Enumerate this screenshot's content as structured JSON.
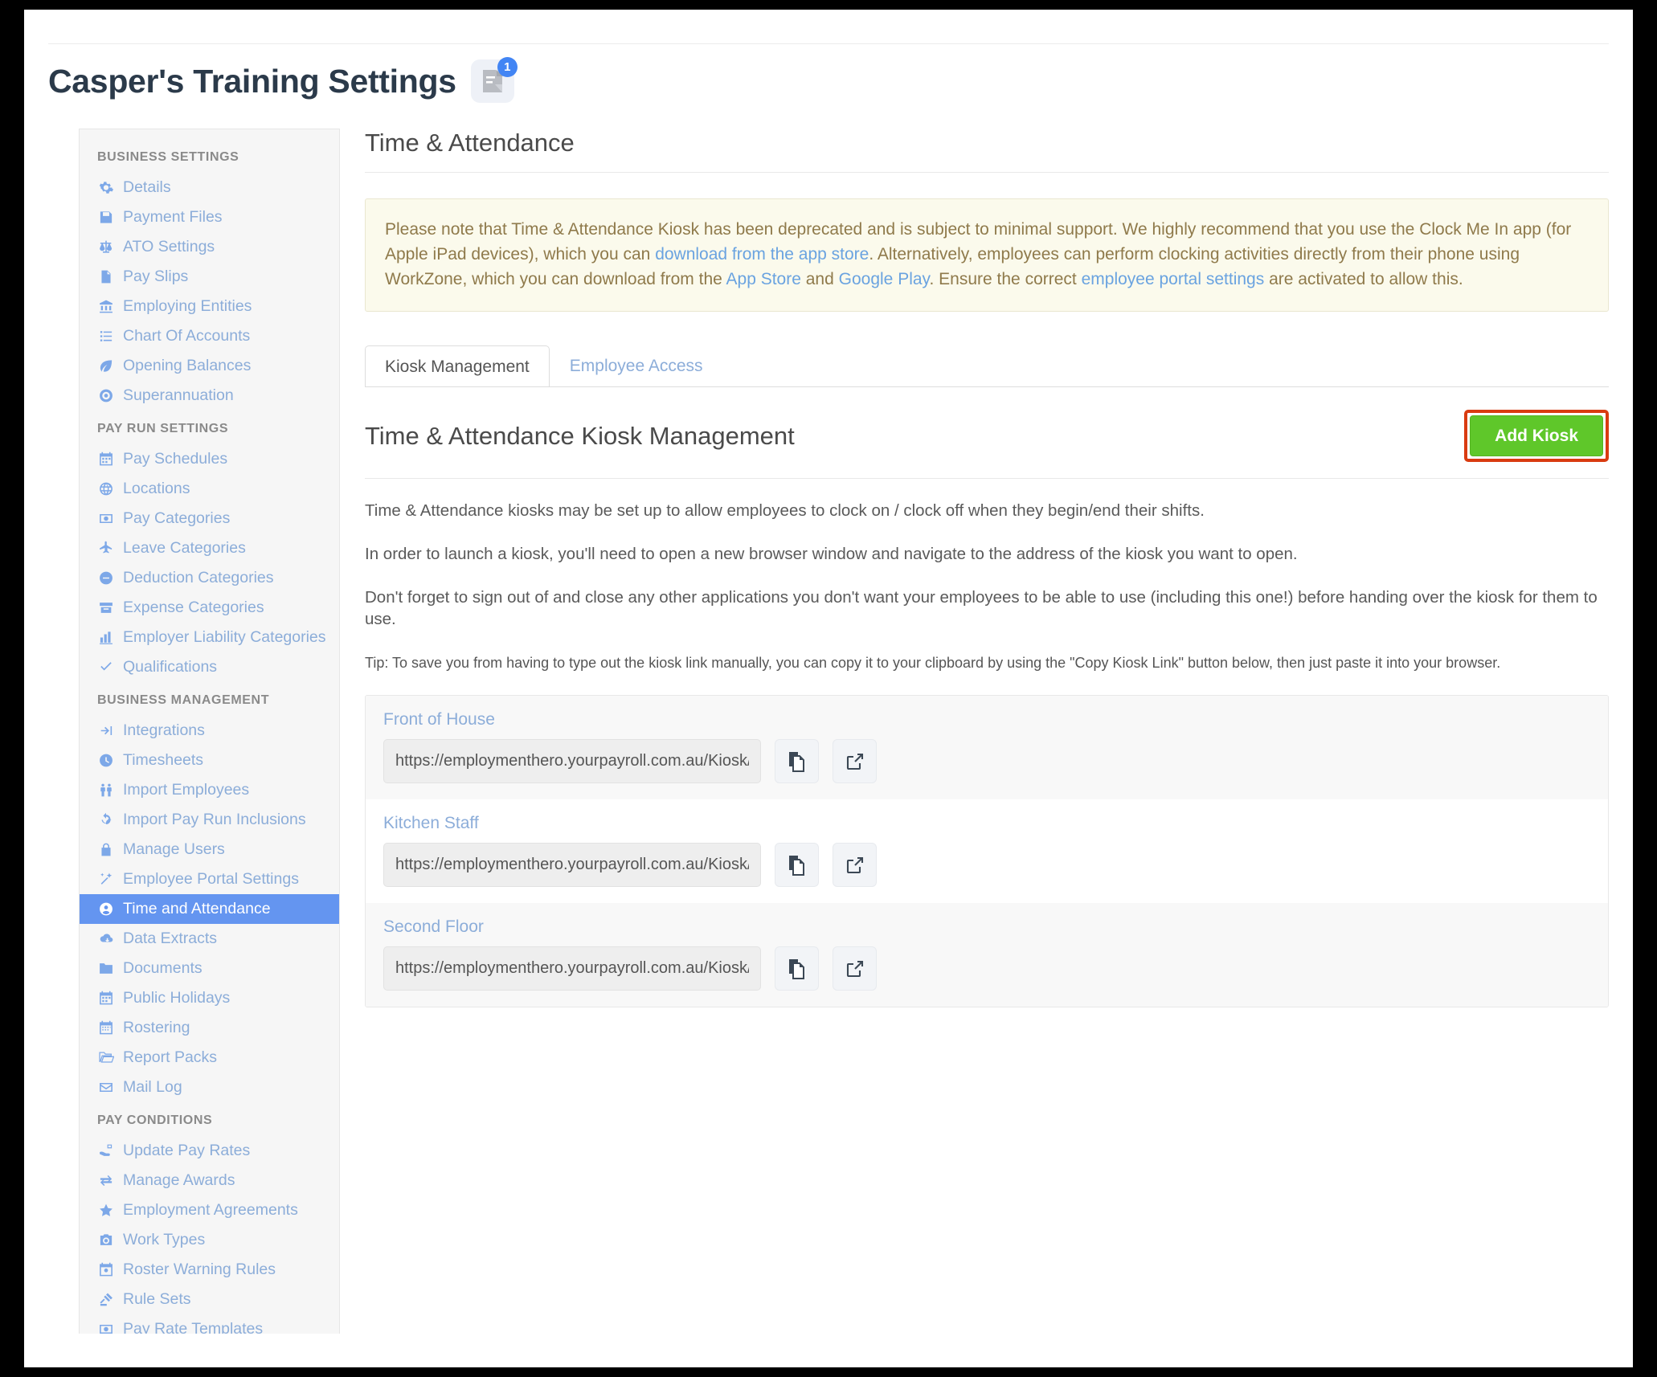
{
  "page": {
    "title": "Casper's Training Settings",
    "badge_count": "1",
    "badge_icon": "document-note-icon"
  },
  "sidebar": {
    "groups": [
      {
        "title": "BUSINESS SETTINGS",
        "items": [
          {
            "label": "Details",
            "icon": "gear-icon"
          },
          {
            "label": "Payment Files",
            "icon": "floppy-disk-icon"
          },
          {
            "label": "ATO Settings",
            "icon": "balance-scale-icon"
          },
          {
            "label": "Pay Slips",
            "icon": "file-icon"
          },
          {
            "label": "Employing Entities",
            "icon": "bank-icon"
          },
          {
            "label": "Chart Of Accounts",
            "icon": "list-icon"
          },
          {
            "label": "Opening Balances",
            "icon": "leaf-icon"
          },
          {
            "label": "Superannuation",
            "icon": "lifebuoy-icon"
          }
        ]
      },
      {
        "title": "PAY RUN SETTINGS",
        "items": [
          {
            "label": "Pay Schedules",
            "icon": "calendar-icon"
          },
          {
            "label": "Locations",
            "icon": "globe-icon"
          },
          {
            "label": "Pay Categories",
            "icon": "money-icon"
          },
          {
            "label": "Leave Categories",
            "icon": "plane-icon"
          },
          {
            "label": "Deduction Categories",
            "icon": "minus-circle-icon"
          },
          {
            "label": "Expense Categories",
            "icon": "archive-icon"
          },
          {
            "label": "Employer Liability Categories",
            "icon": "bar-chart-icon"
          },
          {
            "label": "Qualifications",
            "icon": "check-icon"
          }
        ]
      },
      {
        "title": "BUSINESS MANAGEMENT",
        "items": [
          {
            "label": "Integrations",
            "icon": "share-icon"
          },
          {
            "label": "Timesheets",
            "icon": "clock-icon"
          },
          {
            "label": "Import Employees",
            "icon": "people-icon"
          },
          {
            "label": "Import Pay Run Inclusions",
            "icon": "refresh-icon"
          },
          {
            "label": "Manage Users",
            "icon": "lock-icon"
          },
          {
            "label": "Employee Portal Settings",
            "icon": "magic-wand-icon"
          },
          {
            "label": "Time and Attendance",
            "icon": "user-circle-icon",
            "active": true
          },
          {
            "label": "Data Extracts",
            "icon": "cloud-download-icon"
          },
          {
            "label": "Documents",
            "icon": "folder-icon"
          },
          {
            "label": "Public Holidays",
            "icon": "calendar-icon"
          },
          {
            "label": "Rostering",
            "icon": "calendar-alt-icon"
          },
          {
            "label": "Report Packs",
            "icon": "folder-open-icon"
          },
          {
            "label": "Mail Log",
            "icon": "envelope-icon"
          }
        ]
      },
      {
        "title": "PAY CONDITIONS",
        "items": [
          {
            "label": "Update Pay Rates",
            "icon": "hand-money-icon"
          },
          {
            "label": "Manage Awards",
            "icon": "exchange-icon"
          },
          {
            "label": "Employment Agreements",
            "icon": "star-icon"
          },
          {
            "label": "Work Types",
            "icon": "camera-icon"
          },
          {
            "label": "Roster Warning Rules",
            "icon": "calendar-warning-icon"
          },
          {
            "label": "Rule Sets",
            "icon": "gavel-icon"
          },
          {
            "label": "Pay Rate Templates",
            "icon": "money-icon"
          }
        ]
      }
    ]
  },
  "main": {
    "heading": "Time & Attendance",
    "notice": {
      "part1": "Please note that Time & Attendance Kiosk has been deprecated and is subject to minimal support. We highly recommend that you use the Clock Me In app (for Apple iPad devices), which you can ",
      "link1": "download from the app store",
      "part2": ". Alternatively, employees can perform clocking activities directly from their phone using WorkZone, which you can download from the ",
      "link2": "App Store",
      "part3": " and ",
      "link3": "Google Play",
      "part4": ". Ensure the correct ",
      "link4": "employee portal settings",
      "part5": " are activated to allow this."
    },
    "tabs": [
      {
        "label": "Kiosk Management",
        "active": true
      },
      {
        "label": "Employee Access",
        "active": false
      }
    ],
    "kiosk_section": {
      "title": "Time & Attendance Kiosk Management",
      "add_button": "Add Kiosk",
      "paragraphs": [
        "Time & Attendance kiosks may be set up to allow employees to clock on / clock off when they begin/end their shifts.",
        "In order to launch a kiosk, you'll need to open a new browser window and navigate to the address of the kiosk you want to open.",
        "Don't forget to sign out of and close any other applications you don't want your employees to be able to use (including this one!) before handing over the kiosk for them to use."
      ],
      "tip": "Tip: To save you from having to type out the kiosk link manually, you can copy it to your clipboard by using the \"Copy Kiosk Link\" button below, then just paste it into your browser.",
      "kiosks": [
        {
          "name": "Front of House",
          "url": "https://employmenthero.yourpayroll.com.au/Kiosk/I"
        },
        {
          "name": "Kitchen Staff",
          "url": "https://employmenthero.yourpayroll.com.au/Kiosk/("
        },
        {
          "name": "Second Floor",
          "url": "https://employmenthero.yourpayroll.com.au/Kiosk/\\"
        }
      ]
    }
  },
  "colors": {
    "accent_blue": "#6495f0",
    "link_blue": "#8cadd9",
    "add_button_green": "#5fc72a",
    "highlight_red": "#d93b10",
    "notice_bg": "#fbfaec"
  }
}
